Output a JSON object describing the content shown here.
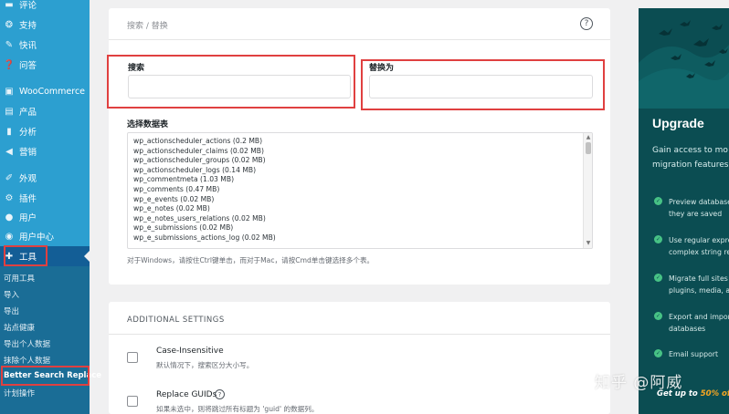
{
  "sidebar": {
    "items": [
      {
        "label": "评论",
        "icon": "comment-icon"
      },
      {
        "label": "支持",
        "icon": "lifebuoy-icon"
      },
      {
        "label": "快讯",
        "icon": "pin-icon"
      },
      {
        "label": "问答",
        "icon": "question-icon"
      },
      {
        "label": "WooCommerce",
        "icon": "woocommerce-icon"
      },
      {
        "label": "产品",
        "icon": "archive-icon"
      },
      {
        "label": "分析",
        "icon": "chart-icon"
      },
      {
        "label": "营销",
        "icon": "megaphone-icon"
      },
      {
        "label": "外观",
        "icon": "brush-icon"
      },
      {
        "label": "插件",
        "icon": "plugin-icon"
      },
      {
        "label": "用户",
        "icon": "user-icon"
      },
      {
        "label": "用户中心",
        "icon": "user-center-icon"
      },
      {
        "label": "工具",
        "icon": "wrench-icon"
      }
    ],
    "submenu": [
      {
        "label": "可用工具"
      },
      {
        "label": "导入"
      },
      {
        "label": "导出"
      },
      {
        "label": "站点健康"
      },
      {
        "label": "导出个人数据"
      },
      {
        "label": "抹除个人数据"
      },
      {
        "label": "Better Search Replace"
      },
      {
        "label": "计划操作"
      }
    ]
  },
  "main": {
    "breadcrumb": "搜索 / 替换",
    "help_glyph": "?",
    "search_label": "搜索",
    "search_value": "",
    "replace_label": "替换为",
    "replace_value": "",
    "select_label": "选择数据表",
    "tables": [
      "wp_actionscheduler_actions (0.2 MB)",
      "wp_actionscheduler_claims (0.02 MB)",
      "wp_actionscheduler_groups (0.02 MB)",
      "wp_actionscheduler_logs (0.14 MB)",
      "wp_commentmeta (1.03 MB)",
      "wp_comments (0.47 MB)",
      "wp_e_events (0.02 MB)",
      "wp_e_notes (0.02 MB)",
      "wp_e_notes_users_relations (0.02 MB)",
      "wp_e_submissions (0.02 MB)",
      "wp_e_submissions_actions_log (0.02 MB)"
    ],
    "tables_hint": "对于Windows，请按住Ctrl键单击，而对于Mac，请按Cmd单击键选择多个表。"
  },
  "settings": {
    "title": "ADDITIONAL SETTINGS",
    "options": [
      {
        "title": "Case-Insensitive",
        "desc": "默认情况下，搜索区分大小写。"
      },
      {
        "title": "Replace GUIDs",
        "desc": "如果未选中，则将跳过所有标题为 'guid' 的数据列。",
        "help_glyph": "?"
      }
    ]
  },
  "upgrade": {
    "title": "Upgrade",
    "intro": [
      "Gain access to mo",
      "migration features"
    ],
    "features": [
      [
        "Preview database",
        "they are saved"
      ],
      [
        "Use regular expre",
        "complex string re"
      ],
      [
        "Migrate full sites",
        "plugins, media, a"
      ],
      [
        "Export and impor",
        "databases"
      ],
      [
        "Email support"
      ]
    ],
    "footer_prefix": "Get up to ",
    "footer_highlight": "50% off",
    "check_glyph": "✓"
  },
  "watermark": "知乎 @阿威",
  "colors": {
    "sidebar": "#2c9fd0",
    "sidebar_sub": "#1a6d96",
    "highlight_border": "#e04040",
    "upgrade_bg": "#0b4d52",
    "check": "#47c285"
  }
}
